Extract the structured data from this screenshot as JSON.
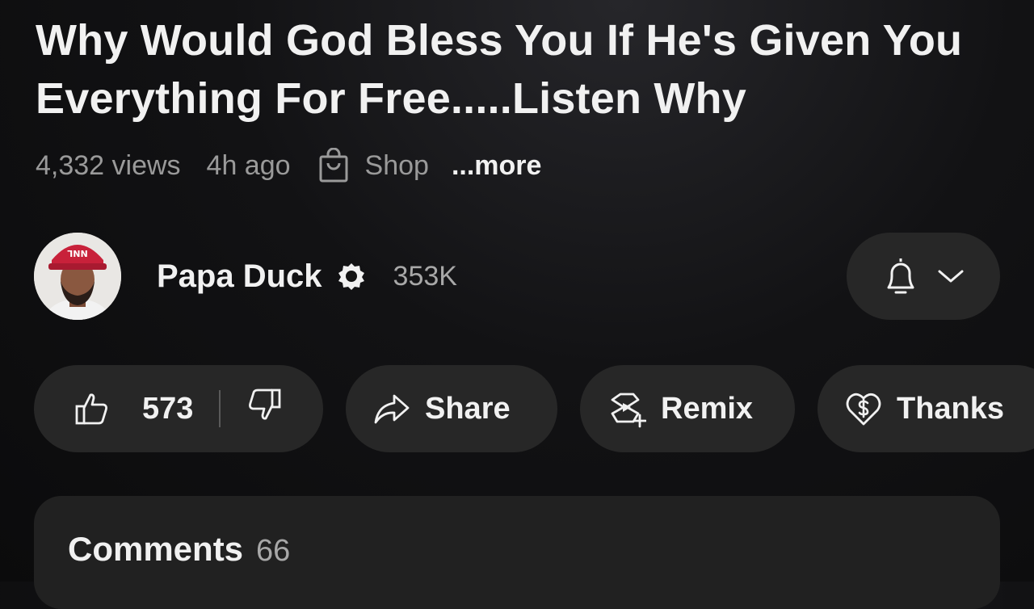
{
  "video": {
    "title": "Why Would God Bless You If He's Given You Everything For Free.....Listen Why",
    "views": "4,332 views",
    "age": "4h ago",
    "shop_label": "Shop",
    "more_label": "...more"
  },
  "channel": {
    "name": "Papa Duck",
    "subscribers": "353K",
    "avatar_cap_text": "NNL"
  },
  "actions": {
    "like_count": "573",
    "share_label": "Share",
    "remix_label": "Remix",
    "thanks_label": "Thanks"
  },
  "comments": {
    "title": "Comments",
    "count": "66"
  },
  "icons": {
    "shop": "shopping-bag-icon",
    "verified": "verified-badge-icon",
    "bell": "bell-icon",
    "chevron": "chevron-down-icon",
    "like": "thumbs-up-icon",
    "dislike": "thumbs-down-icon",
    "share": "share-arrow-icon",
    "remix": "remix-icon",
    "thanks": "thanks-heart-dollar-icon"
  },
  "colors": {
    "background": "#0f0f0f",
    "pill": "#272727",
    "text_primary": "#f1f1f1",
    "text_secondary": "#9a9a9a"
  }
}
